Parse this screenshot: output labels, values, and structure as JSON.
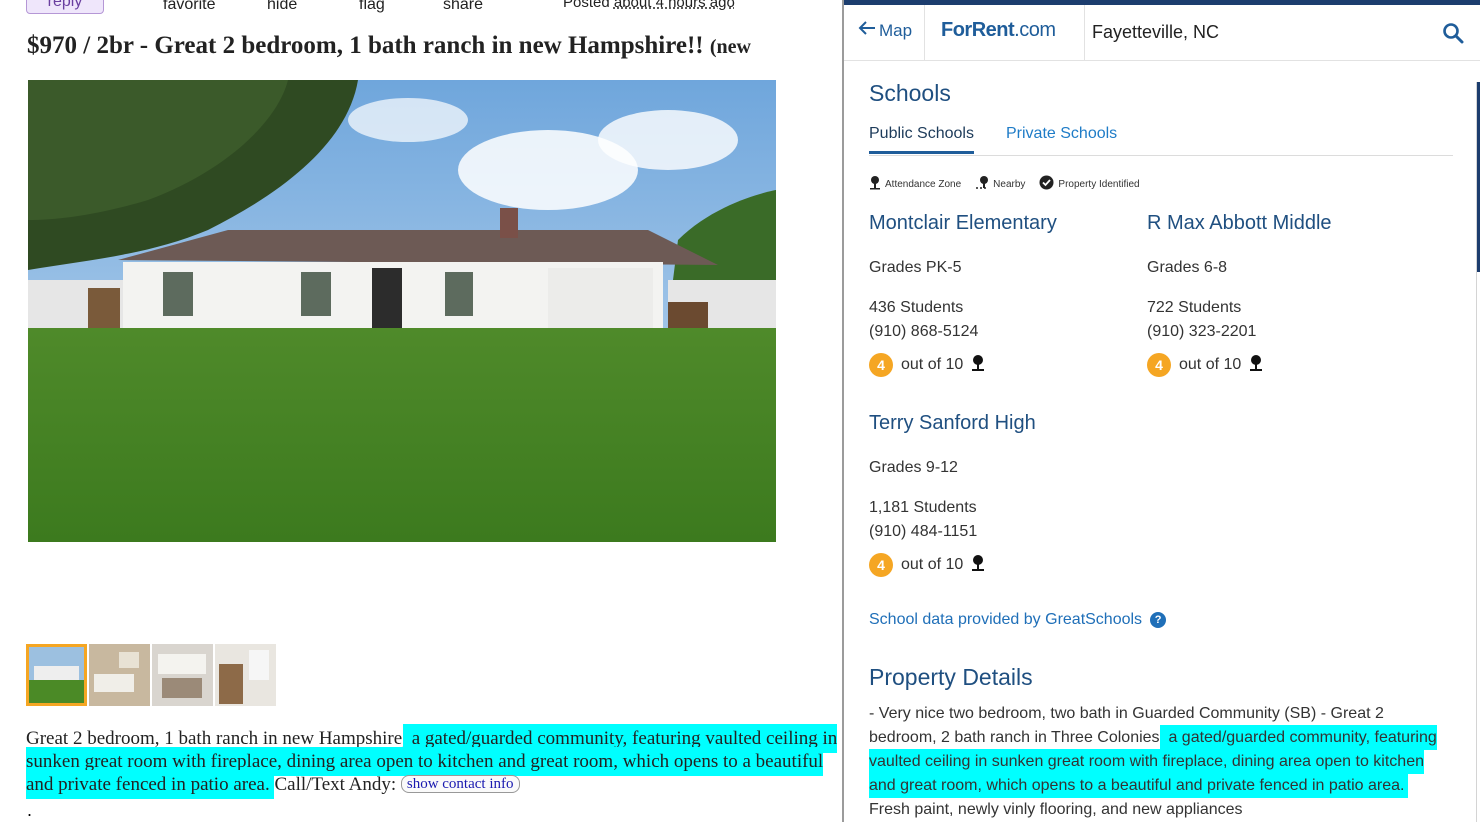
{
  "craigslist": {
    "reply_label": "reply",
    "actions": [
      "favorite",
      "hide",
      "flag",
      "share"
    ],
    "posted_prefix": "Posted",
    "posted_ago": "about 4 hours ago",
    "title": "$970 / 2br - Great 2 bedroom, 1 bath ranch in new Hampshire!!",
    "title_location": "(new",
    "body_plain": "Great 2 bedroom, 1 bath ranch in new Hampshire,",
    "body_highlight": " a gated/guarded community, featuring vaulted ceiling in sunken great room with fireplace, dining area open to kitchen and great room, which opens to a beautiful and private fenced in patio area.",
    "body_after": " Call/Text Andy:",
    "contact_button": "show contact info",
    "trailing": "."
  },
  "forrent": {
    "back_label": "Map",
    "logo_main": "ForRent",
    "logo_suffix": ".com",
    "search_value": "Fayetteville, NC",
    "schools_heading": "Schools",
    "tabs": [
      "Public Schools",
      "Private Schools"
    ],
    "legend": [
      "Attendance Zone",
      "Nearby",
      "Property Identified"
    ],
    "out_of_label": "out of 10",
    "schools": [
      {
        "name": "Montclair Elementary",
        "grades": "Grades PK-5",
        "students": "436 Students",
        "phone": "(910) 868-5124",
        "rating": "4"
      },
      {
        "name": "R Max Abbott Middle",
        "grades": "Grades 6-8",
        "students": "722 Students",
        "phone": "(910) 323-2201",
        "rating": "4"
      },
      {
        "name": "Terry Sanford High",
        "grades": "Grades 9-12",
        "students": "1,181 Students",
        "phone": "(910) 484-1151",
        "rating": "4"
      }
    ],
    "greatschools_link": "School data provided by GreatSchools",
    "property_heading": "Property Details",
    "desc_plain": "- Very nice two bedroom, two bath in Guarded Community (SB) - Great 2 bedroom, 2 bath ranch in Three Colonies,",
    "desc_highlight": " a gated/guarded community, featuring vaulted ceiling in sunken great room with fireplace, dining area open to kitchen and great room, which opens to a beautiful and private fenced in patio area.",
    "desc_after": "Fresh paint, newly vinly flooring, and new appliances"
  },
  "colors": {
    "highlight": "#00ffff",
    "brand_blue": "#1f5d9a",
    "rating_orange": "#f5a623"
  }
}
